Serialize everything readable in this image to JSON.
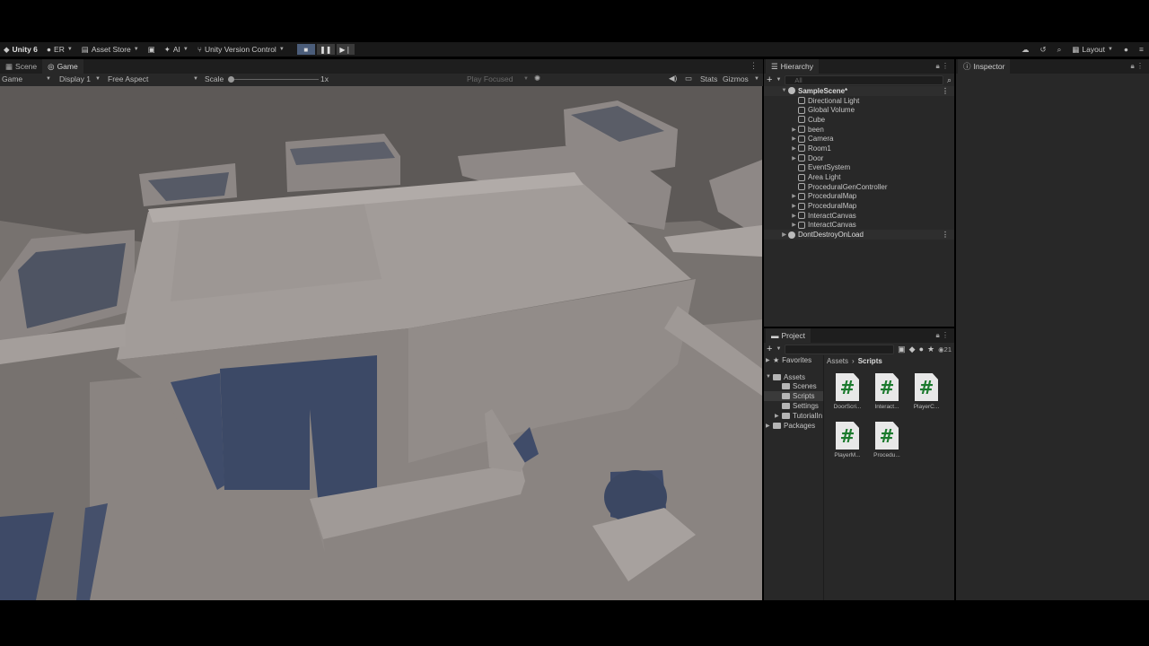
{
  "toolbar": {
    "app": "Unity 6",
    "account": "ER",
    "asset_store": "Asset Store",
    "ai": "AI",
    "vcs": "Unity Version Control",
    "layout": "Layout"
  },
  "left_tabs": {
    "scene": "Scene",
    "game": "Game"
  },
  "game_bar": {
    "mode": "Game",
    "display": "Display 1",
    "aspect": "Free Aspect",
    "scale_label": "Scale",
    "scale_value": "1x",
    "play_focused": "Play Focused",
    "stats": "Stats",
    "gizmos": "Gizmos"
  },
  "hierarchy": {
    "title": "Hierarchy",
    "search_placeholder": "All",
    "scene": "SampleScene*",
    "items": [
      {
        "label": "Directional Light",
        "expandable": false
      },
      {
        "label": "Global Volume",
        "expandable": false
      },
      {
        "label": "Cube",
        "expandable": false
      },
      {
        "label": "been",
        "expandable": true
      },
      {
        "label": "Camera",
        "expandable": true
      },
      {
        "label": "Room1",
        "expandable": true
      },
      {
        "label": "Door",
        "expandable": true
      },
      {
        "label": "EventSystem",
        "expandable": false
      },
      {
        "label": "Area Light",
        "expandable": false
      },
      {
        "label": "ProceduralGenController",
        "expandable": false
      },
      {
        "label": "ProceduralMap",
        "expandable": true
      },
      {
        "label": "ProceduralMap",
        "expandable": true
      },
      {
        "label": "InteractCanvas",
        "expandable": true
      },
      {
        "label": "InteractCanvas",
        "expandable": true
      }
    ],
    "dont_destroy": "DontDestroyOnLoad"
  },
  "project": {
    "title": "Project",
    "count": "21",
    "favorites": "Favorites",
    "assets": "Assets",
    "folders": [
      "Scenes",
      "Scripts",
      "Settings",
      "TutorialIn"
    ],
    "packages": "Packages",
    "breadcrumb": [
      "Assets",
      "Scripts"
    ],
    "files": [
      "DoorScri...",
      "Interact...",
      "PlayerC...",
      "PlayerM...",
      "Procedu..."
    ]
  },
  "inspector": {
    "title": "Inspector"
  },
  "colors": {
    "accent_play": "#4b5d7a",
    "script_hash": "#1b7a2d"
  }
}
